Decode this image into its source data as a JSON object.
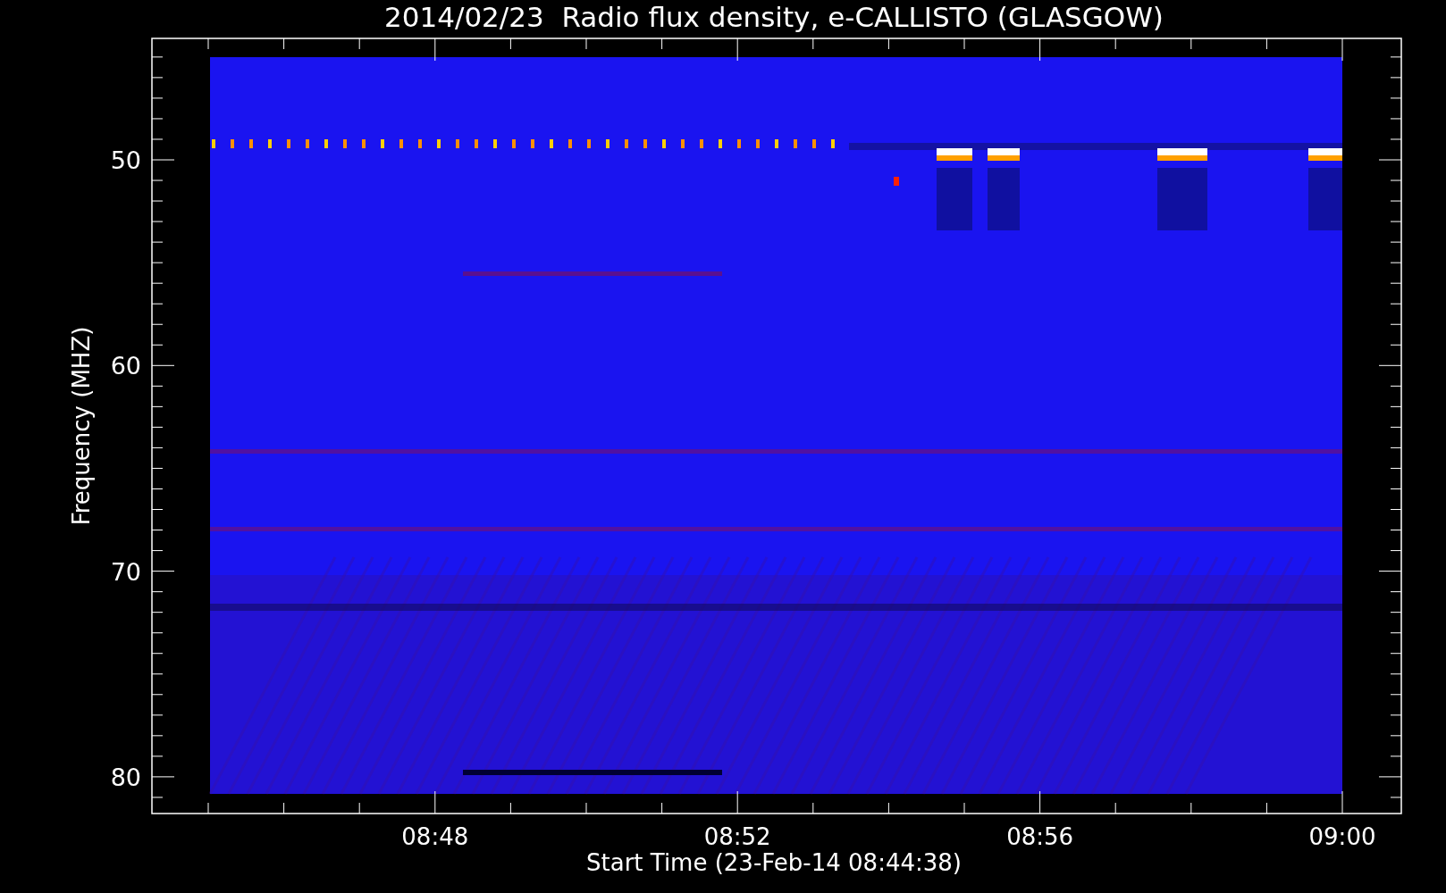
{
  "title": "2014/02/23  Radio flux density, e-CALLISTO (GLASGOW)",
  "ylabel": "Frequency (MHZ)",
  "xlabel": "Start Time (23-Feb-14 08:44:38)",
  "yticks": [
    "50",
    "60",
    "70",
    "80"
  ],
  "xticks": [
    "08:48",
    "08:52",
    "08:56",
    "09:00"
  ]
}
